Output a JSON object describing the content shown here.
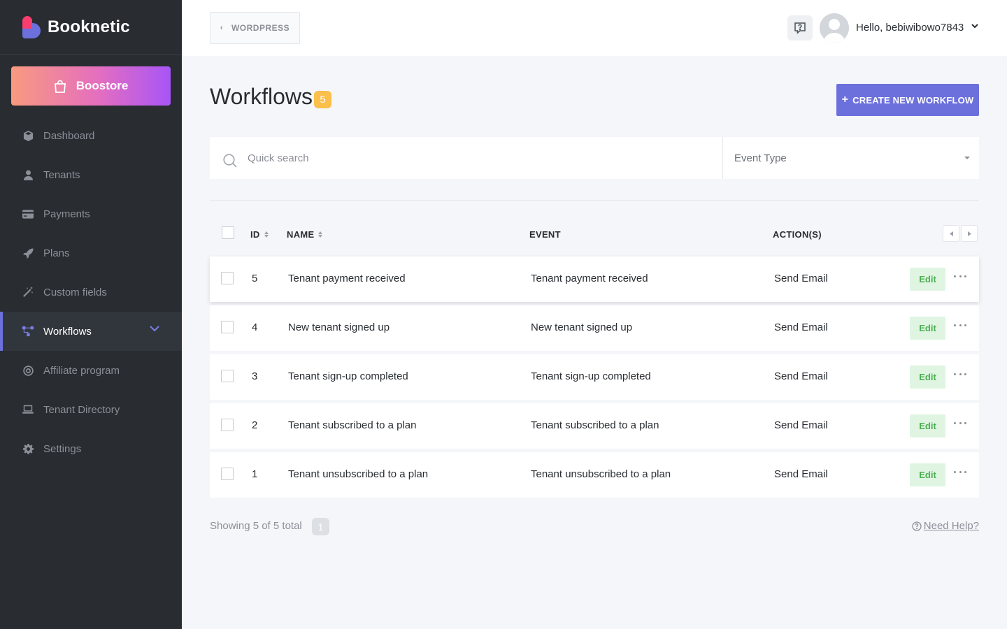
{
  "sidebar": {
    "brand": "Booknetic",
    "boostore_label": "Boostore",
    "items": [
      {
        "label": "Dashboard",
        "icon": "cube-icon"
      },
      {
        "label": "Tenants",
        "icon": "user-icon"
      },
      {
        "label": "Payments",
        "icon": "credit-card-icon"
      },
      {
        "label": "Plans",
        "icon": "rocket-icon"
      },
      {
        "label": "Custom fields",
        "icon": "magic-wand-icon"
      },
      {
        "label": "Workflows",
        "icon": "workflow-icon",
        "active": true
      },
      {
        "label": "Affiliate program",
        "icon": "target-icon"
      },
      {
        "label": "Tenant Directory",
        "icon": "laptop-icon"
      },
      {
        "label": "Settings",
        "icon": "gear-icon"
      }
    ]
  },
  "topbar": {
    "back_label": "WORDPRESS",
    "greeting": "Hello, bebiwibowo7843"
  },
  "header": {
    "title": "Workflows",
    "count": "5",
    "create_label": "CREATE NEW WORKFLOW"
  },
  "filters": {
    "search_placeholder": "Quick search",
    "event_type_label": "Event Type"
  },
  "table": {
    "columns": {
      "id": "ID",
      "name": "NAME",
      "event": "EVENT",
      "actions": "ACTION(S)"
    },
    "rows": [
      {
        "id": "5",
        "name": "Tenant payment received",
        "event": "Tenant payment received",
        "action": "Send Email",
        "edit": "Edit"
      },
      {
        "id": "4",
        "name": "New tenant signed up",
        "event": "New tenant signed up",
        "action": "Send Email",
        "edit": "Edit"
      },
      {
        "id": "3",
        "name": "Tenant sign-up completed",
        "event": "Tenant sign-up completed",
        "action": "Send Email",
        "edit": "Edit"
      },
      {
        "id": "2",
        "name": "Tenant subscribed to a plan",
        "event": "Tenant subscribed to a plan",
        "action": "Send Email",
        "edit": "Edit"
      },
      {
        "id": "1",
        "name": "Tenant unsubscribed to a plan",
        "event": "Tenant unsubscribed to a plan",
        "action": "Send Email",
        "edit": "Edit"
      }
    ]
  },
  "footer": {
    "showing": "Showing 5 of 5 total",
    "page": "1",
    "help_label": "Need Help?"
  },
  "colors": {
    "sidebar_bg": "#292d32",
    "accent": "#6c70dc",
    "badge": "#fbbf4a",
    "edit_bg": "#dff5e2",
    "edit_text": "#4caf50"
  }
}
